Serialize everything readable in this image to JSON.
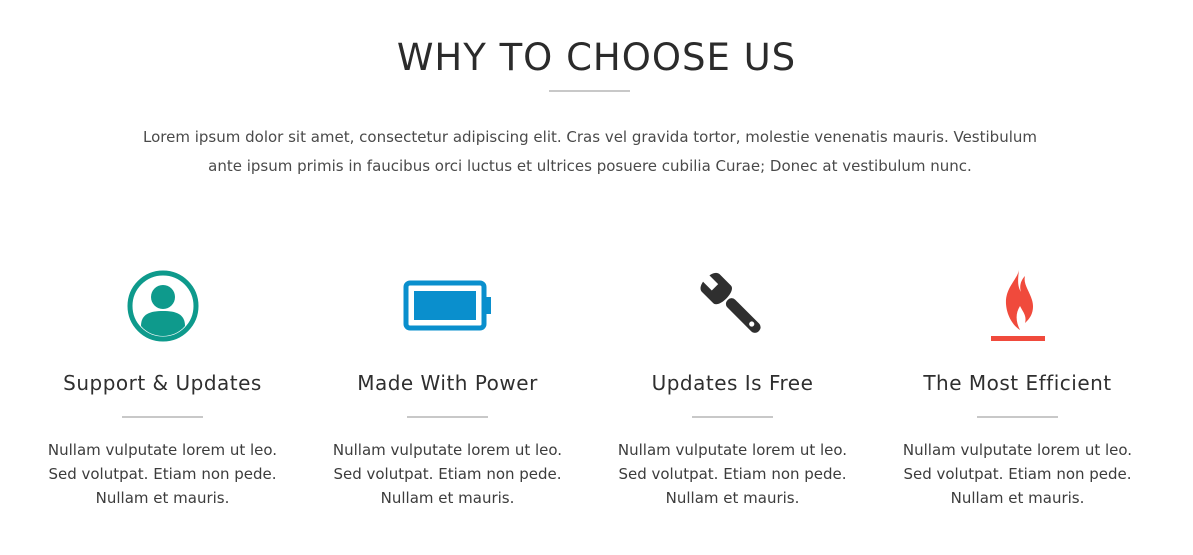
{
  "section": {
    "title": "WHY TO CHOOSE US",
    "intro_line1": "Lorem ipsum dolor sit amet, consectetur adipiscing elit. Cras vel gravida tortor, molestie venenatis mauris. Vestibulum",
    "intro_line2": "ante ipsum primis in faucibus orci luctus et ultrices posuere cubilia Curae; Donec at vestibulum nunc."
  },
  "features": [
    {
      "icon": "user-circle-icon",
      "icon_color": "#0e9a8c",
      "title": "Support & Updates",
      "lines": [
        "Nullam vulputate lorem ut leo.",
        "Sed volutpat. Etiam non pede.",
        "Nullam et mauris."
      ]
    },
    {
      "icon": "battery-icon",
      "icon_color": "#0a8fcd",
      "title": "Made With Power",
      "lines": [
        "Nullam vulputate lorem ut leo.",
        "Sed volutpat. Etiam non pede.",
        "Nullam et mauris."
      ]
    },
    {
      "icon": "wrench-icon",
      "icon_color": "#2f2f2f",
      "title": "Updates Is Free",
      "lines": [
        "Nullam vulputate lorem ut leo.",
        "Sed volutpat. Etiam non pede.",
        "Nullam et mauris."
      ]
    },
    {
      "icon": "fire-icon",
      "icon_color": "#f04a3c",
      "title": "The Most Efficient",
      "lines": [
        "Nullam vulputate lorem ut leo.",
        "Sed volutpat. Etiam non pede.",
        "Nullam et mauris."
      ]
    }
  ]
}
